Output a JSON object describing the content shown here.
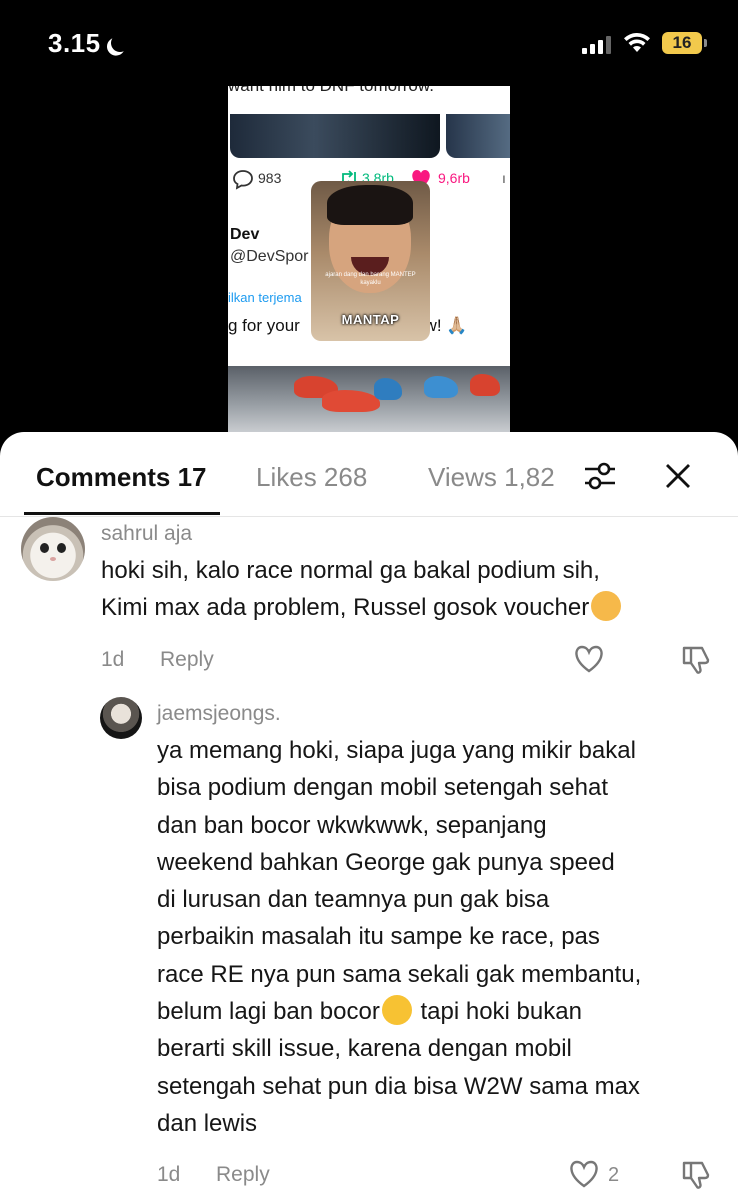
{
  "status_bar": {
    "time": "3.15",
    "battery": "16"
  },
  "preview": {
    "caption": "want him to DNF tomorrow.",
    "stats": {
      "replies": "983",
      "reposts": "3,8rb",
      "likes": "9,6rb"
    },
    "author_name": "Dev",
    "author_handle": "@DevSpor",
    "translate": "ilkan terjema",
    "tweet": "g for your ",
    "tweet_end": "w! 🙏🏼",
    "facecam_caption": "ajaran dang dan barang MANTEP kayaklu",
    "facecam_label": "MANTAP"
  },
  "tabs": {
    "comments": "Comments 17",
    "likes": "Likes 268",
    "views": "Views 1,82"
  },
  "comments": [
    {
      "username": "sahrul aja",
      "lines": [
        "hoki sih, kalo race normal ga bakal podium sih,",
        "Kimi max ada problem, Russel gosok voucher"
      ],
      "time": "1d",
      "reply": "Reply"
    },
    {
      "username": "jaemsjeongs.",
      "lines": [
        "ya memang hoki, siapa juga yang mikir bakal",
        "bisa podium dengan mobil setengah sehat",
        "dan ban bocor wkwkwwk, sepanjang",
        "weekend bahkan George gak punya speed",
        "di lurusan dan teamnya pun gak bisa",
        "perbaikin masalah itu sampe ke race, pas",
        "race RE nya pun sama sekali gak membantu,",
        "belum lagi ban bocor",
        " tapi hoki bukan",
        "berarti skill issue, karena dengan mobil",
        "setengah sehat pun dia bisa W2W sama max",
        "dan lewis"
      ],
      "time": "1d",
      "reply": "Reply",
      "likes": "2"
    }
  ]
}
